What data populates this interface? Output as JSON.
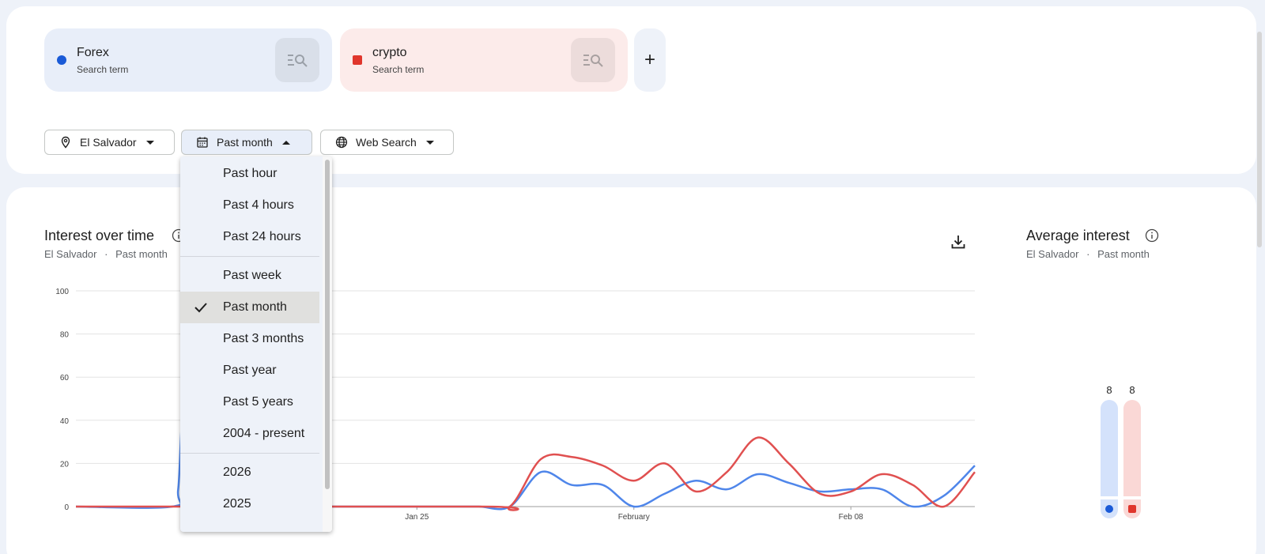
{
  "terms": [
    {
      "name": "Forex",
      "sub": "Search term",
      "color": "#1a5ad7",
      "bg": "#e8eef9",
      "btn_bg": "#d9dfe9"
    },
    {
      "name": "crypto",
      "sub": "Search term",
      "color": "#e0362c",
      "bg": "#fcebea",
      "btn_bg": "#ecdcdb"
    }
  ],
  "add_label": "+",
  "filters": {
    "location": "El Salvador",
    "time": "Past month",
    "property": "Web Search"
  },
  "interest_over_time": {
    "title": "Interest over time",
    "subtitle_location": "El Salvador",
    "subtitle_sep": "·",
    "subtitle_time": "Past month"
  },
  "average_interest": {
    "title": "Average interest",
    "subtitle_location": "El Salvador",
    "subtitle_sep": "·",
    "subtitle_time": "Past month",
    "values": [
      8,
      8
    ]
  },
  "time_menu": {
    "groups": [
      [
        "Past hour",
        "Past 4 hours",
        "Past 24 hours"
      ],
      [
        "Past week",
        "Past month",
        "Past 3 months",
        "Past year",
        "Past 5 years",
        "2004 - present"
      ],
      [
        "2026",
        "2025"
      ]
    ],
    "selected": "Past month"
  },
  "chart_data": {
    "type": "line",
    "ylim": [
      0,
      100
    ],
    "yticks": [
      0,
      20,
      40,
      60,
      80,
      100
    ],
    "xticks": [
      {
        "label": "Jan 25",
        "x": 10
      },
      {
        "label": "February",
        "x": 17
      },
      {
        "label": "Feb 08",
        "x": 24
      }
    ],
    "xrange": [
      -1,
      28
    ],
    "series": [
      {
        "name": "Forex",
        "color": "#4f86ea",
        "x": [
          -1,
          2.1,
          2.3,
          2.5,
          3,
          4,
          5,
          6,
          7,
          8,
          9,
          10,
          11,
          12,
          13,
          14,
          15,
          16,
          17,
          18,
          19,
          20,
          21,
          22,
          23,
          24,
          25,
          26,
          27,
          28
        ],
        "values": [
          0,
          0,
          8,
          45,
          0,
          0,
          0,
          0,
          0,
          0,
          0,
          0,
          0,
          0,
          0,
          16,
          10,
          10,
          0,
          6,
          12,
          8,
          15,
          11,
          7,
          8,
          8,
          0,
          5,
          19
        ]
      },
      {
        "name": "crypto",
        "color": "#e05050",
        "x": [
          -1,
          12,
          13,
          14,
          15,
          16,
          17,
          18,
          19,
          20,
          21,
          22,
          23,
          24,
          25,
          26,
          27,
          28
        ],
        "values": [
          0,
          0,
          0,
          22,
          23,
          19,
          12,
          20,
          7,
          16,
          32,
          20,
          6,
          7,
          15,
          10,
          0,
          16
        ]
      }
    ]
  }
}
